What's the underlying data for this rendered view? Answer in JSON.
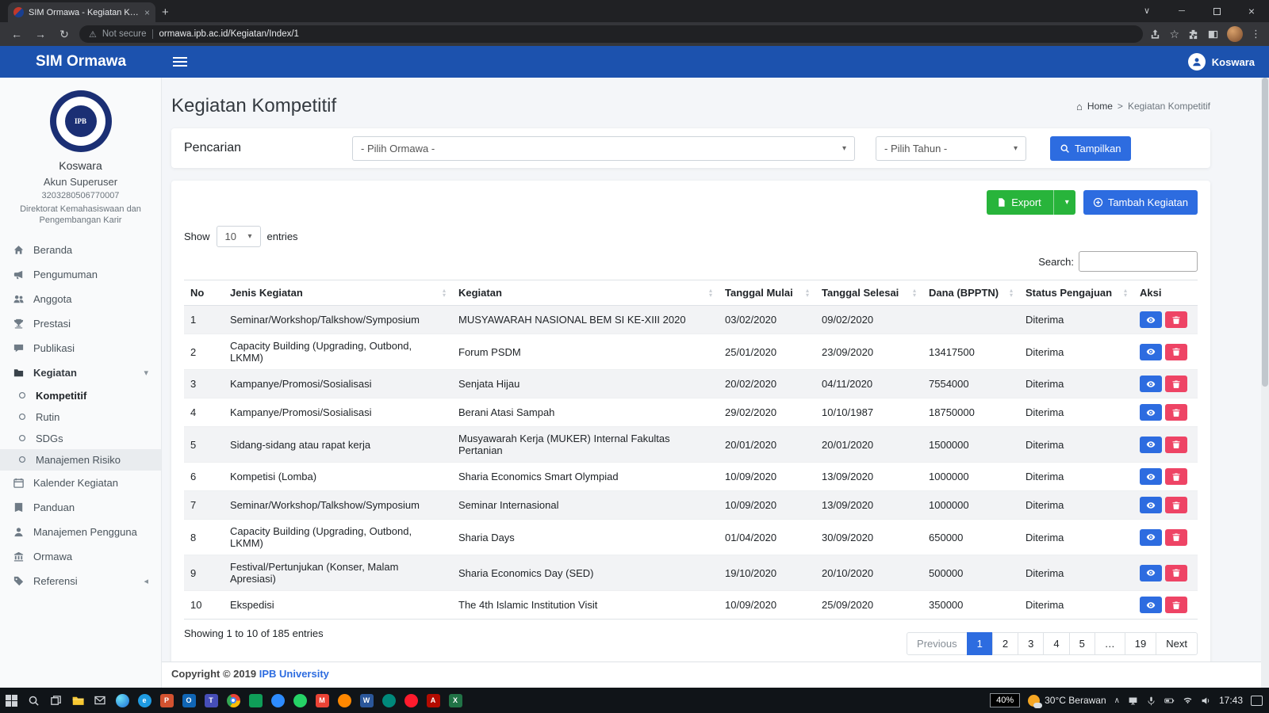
{
  "browser": {
    "tab_title": "SIM Ormawa - Kegiatan Kompet",
    "not_secure_label": "Not secure",
    "url": "ormawa.ipb.ac.id/Kegiatan/Index/1"
  },
  "icons": {
    "back": "←",
    "forward": "→",
    "reload": "↻",
    "warning": "⚠",
    "star": "☆",
    "menu_dots": "⋮",
    "tab_caret": "∨",
    "new_tab": "+",
    "close": "×",
    "minimize": "─",
    "home_glyph": "⌂",
    "breadcrumb_sep": ">",
    "caret_down": "▾",
    "chevron_left": "◂",
    "sort_up": "▴",
    "sort_down": "▾",
    "tray_caret": "∧"
  },
  "app_header": {
    "brand": "SIM Ormawa",
    "user": "Koswara"
  },
  "sidebar": {
    "profile": {
      "name": "Koswara",
      "role": "Akun Superuser",
      "member_id": "3203280506770007",
      "unit": "Direktorat Kemahasiswaan dan Pengembangan Karir"
    },
    "items": [
      "Beranda",
      "Pengumuman",
      "Anggota",
      "Prestasi",
      "Publikasi",
      "Kegiatan",
      "Kompetitif",
      "Rutin",
      "SDGs",
      "Manajemen Risiko",
      "Kalender Kegiatan",
      "Panduan",
      "Manajemen Pengguna",
      "Ormawa",
      "Referensi"
    ]
  },
  "page": {
    "title": "Kegiatan Kompetitif",
    "breadcrumb": [
      "Home",
      "Kegiatan Kompetitif"
    ]
  },
  "search_panel": {
    "label": "Pencarian",
    "ormawa_select": "- Pilih Ormawa -",
    "tahun_select": "- Pilih Tahun -",
    "submit_label": "Tampilkan"
  },
  "actions": {
    "export_label": "Export",
    "add_label": "Tambah Kegiatan"
  },
  "datatable": {
    "show_label": "Show",
    "entries_label": "entries",
    "page_size": "10",
    "search_label": "Search:",
    "search_value": "",
    "headers": [
      "No",
      "Jenis Kegiatan",
      "Kegiatan",
      "Tanggal Mulai",
      "Tanggal Selesai",
      "Dana (BPPTN)",
      "Status Pengajuan",
      "Aksi"
    ],
    "rows": [
      [
        "1",
        "Seminar/Workshop/Talkshow/Symposium",
        "MUSYAWARAH NASIONAL BEM SI KE-XIII 2020",
        "03/02/2020",
        "09/02/2020",
        "",
        "Diterima"
      ],
      [
        "2",
        "Capacity Building (Upgrading, Outbond, LKMM)",
        "Forum PSDM",
        "25/01/2020",
        "23/09/2020",
        "13417500",
        "Diterima"
      ],
      [
        "3",
        "Kampanye/Promosi/Sosialisasi",
        "Senjata Hijau",
        "20/02/2020",
        "04/11/2020",
        "7554000",
        "Diterima"
      ],
      [
        "4",
        "Kampanye/Promosi/Sosialisasi",
        "Berani Atasi Sampah",
        "29/02/2020",
        "10/10/1987",
        "18750000",
        "Diterima"
      ],
      [
        "5",
        "Sidang-sidang atau rapat kerja",
        "Musyawarah Kerja (MUKER) Internal Fakultas Pertanian",
        "20/01/2020",
        "20/01/2020",
        "1500000",
        "Diterima"
      ],
      [
        "6",
        "Kompetisi (Lomba)",
        "Sharia Economics Smart Olympiad",
        "10/09/2020",
        "13/09/2020",
        "1000000",
        "Diterima"
      ],
      [
        "7",
        "Seminar/Workshop/Talkshow/Symposium",
        "Seminar Internasional",
        "10/09/2020",
        "13/09/2020",
        "1000000",
        "Diterima"
      ],
      [
        "8",
        "Capacity Building (Upgrading, Outbond, LKMM)",
        "Sharia Days",
        "01/04/2020",
        "30/09/2020",
        "650000",
        "Diterima"
      ],
      [
        "9",
        "Festival/Pertunjukan (Konser, Malam Apresiasi)",
        "Sharia Economics Day (SED)",
        "19/10/2020",
        "20/10/2020",
        "500000",
        "Diterima"
      ],
      [
        "10",
        "Ekspedisi",
        "The 4th Islamic Institution Visit",
        "10/09/2020",
        "25/09/2020",
        "350000",
        "Diterima"
      ]
    ],
    "info": "Showing 1 to 10 of 185 entries",
    "pagination": [
      "Previous",
      "1",
      "2",
      "3",
      "4",
      "5",
      "…",
      "19",
      "Next"
    ]
  },
  "footer": {
    "copyright": "Copyright © 2019",
    "link_label": "IPB University"
  },
  "taskbar": {
    "battery_badge": "40%",
    "weather": "30°C Berawan",
    "time": "17:43"
  },
  "colors": {
    "header_blue": "#1c52ae",
    "accent_blue": "#2d6ce0",
    "success_green": "#28b43b",
    "danger_red": "#ee4465"
  }
}
